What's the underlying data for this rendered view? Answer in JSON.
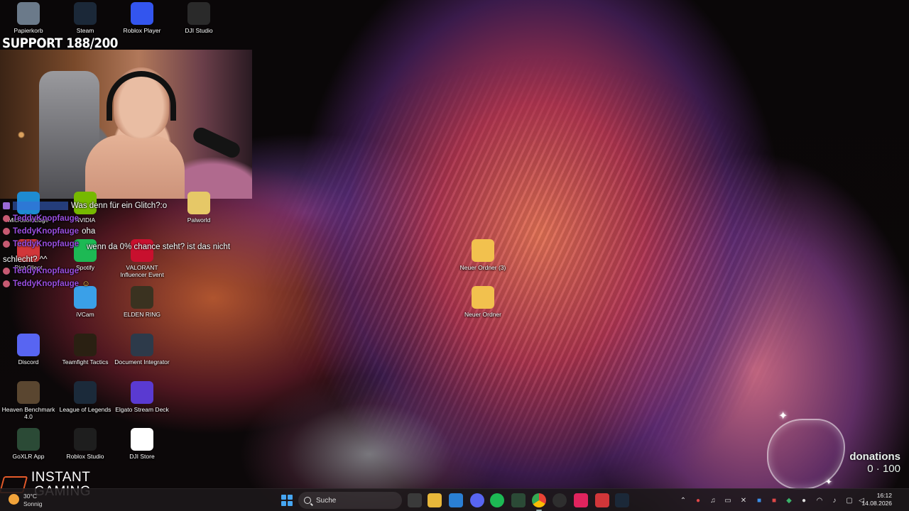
{
  "overlay": {
    "support_goal": "SUPPORT 188/200",
    "donations_label": "donations",
    "donations_value": "0 · 100",
    "sponsor_line1": "INSTANT",
    "sponsor_line2": "GAMING"
  },
  "chat": [
    {
      "user": "",
      "text": "Was denn für ein Glitch?:o"
    },
    {
      "user": "TeddyKnopfauge",
      "text": ""
    },
    {
      "user": "TeddyKnopfauge",
      "text": "oha"
    },
    {
      "user": "TeddyKnopfauge",
      "text": "wenn da 0% chance steht? ist das nicht schlecht? ^^"
    },
    {
      "user": "TeddyKnopfauge",
      "text": ""
    },
    {
      "user": "TeddyKnopfauge",
      "text": ""
    }
  ],
  "desktop_icons": [
    {
      "label": "Papierkorb",
      "icon": "recycle-bin-icon",
      "color": "#6b7a8a"
    },
    {
      "label": "Steam",
      "icon": "steam-icon",
      "color": "#1b2838"
    },
    {
      "label": "Roblox Player",
      "icon": "roblox-icon",
      "color": "#3355ee"
    },
    {
      "label": "DJI Studio",
      "icon": "dji-icon",
      "color": "#2a2a2a"
    },
    {
      "label": "Microsoft Edge",
      "icon": "edge-icon",
      "color": "#1e8bd1"
    },
    {
      "label": "NVIDIA",
      "icon": "nvidia-icon",
      "color": "#76b900"
    },
    {
      "label": "Palworld",
      "icon": "palworld-icon",
      "color": "#e6c867"
    },
    {
      "label": "Riot Client",
      "icon": "riot-icon",
      "color": "#d13639"
    },
    {
      "label": "Spotify",
      "icon": "spotify-icon",
      "color": "#1db954"
    },
    {
      "label": "VALORANT Influencer Event",
      "icon": "valorant-icon",
      "color": "#c8102e"
    },
    {
      "label": "iVCam",
      "icon": "ivcam-icon",
      "color": "#3aa0e8"
    },
    {
      "label": "ELDEN RING",
      "icon": "elden-ring-icon",
      "color": "#3a3220"
    },
    {
      "label": "Discord",
      "icon": "discord-icon",
      "color": "#5865f2"
    },
    {
      "label": "Teamfight Tactics",
      "icon": "tft-icon",
      "color": "#2a2012"
    },
    {
      "label": "Document Integrator",
      "icon": "document-integrator-icon",
      "color": "#2d3a4a"
    },
    {
      "label": "Heaven Benchmark 4.0",
      "icon": "heaven-benchmark-icon",
      "color": "#5a4630"
    },
    {
      "label": "League of Legends",
      "icon": "league-icon",
      "color": "#1b2a3a"
    },
    {
      "label": "Elgato Stream Deck",
      "icon": "stream-deck-icon",
      "color": "#5a3ad1"
    },
    {
      "label": "GoXLR App",
      "icon": "goxlr-icon",
      "color": "#2b4a36"
    },
    {
      "label": "Roblox Studio",
      "icon": "roblox-studio-icon",
      "color": "#1e1e1e"
    },
    {
      "label": "DJI Store",
      "icon": "dji-store-icon",
      "color": "#ffffff"
    },
    {
      "label": "Neuer Ordner (3)",
      "icon": "folder-icon",
      "color": "#f2c14e"
    },
    {
      "label": "Neuer Ordner",
      "icon": "folder-icon",
      "color": "#f2c14e"
    }
  ],
  "taskbar": {
    "weather_temp": "30°C",
    "weather_condition": "Sonnig",
    "search_placeholder": "Suche",
    "time": "16:12",
    "date": "14.08.2026"
  }
}
